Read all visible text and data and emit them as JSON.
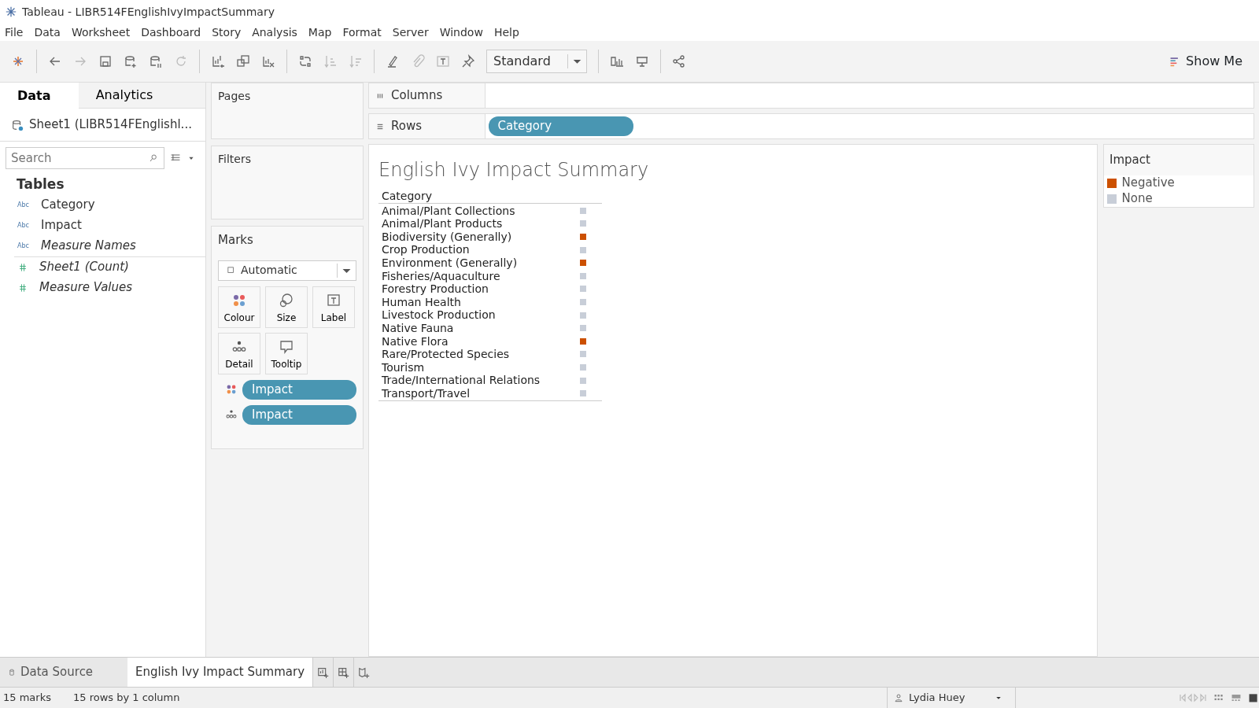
{
  "window": {
    "title": "Tableau - LIBR514FEnglishIvyImpactSummary"
  },
  "menu": [
    "File",
    "Data",
    "Worksheet",
    "Dashboard",
    "Story",
    "Analysis",
    "Map",
    "Format",
    "Server",
    "Window",
    "Help"
  ],
  "toolbar": {
    "fit": "Standard",
    "show_me": "Show Me"
  },
  "data_pane": {
    "tabs": [
      {
        "label": "Data",
        "selected": true
      },
      {
        "label": "Analytics",
        "selected": false
      }
    ],
    "datasource": "Sheet1 (LIBR514FEnglishl...",
    "search": {
      "placeholder": "Search"
    },
    "section": "Tables",
    "fields": [
      {
        "name": "Category",
        "kind": "dimension",
        "type_label": "Abc",
        "generated": false
      },
      {
        "name": "Impact",
        "kind": "dimension",
        "type_label": "Abc",
        "generated": false
      },
      {
        "name": "Measure Names",
        "kind": "dimension",
        "type_label": "Abc",
        "generated": true
      },
      {
        "name": "Sheet1 (Count)",
        "kind": "measure",
        "generated": true
      },
      {
        "name": "Measure Values",
        "kind": "measure",
        "generated": true
      }
    ]
  },
  "shelves": {
    "pages": "Pages",
    "filters": "Filters",
    "columns": {
      "label": "Columns"
    },
    "rows": {
      "label": "Rows",
      "pills": [
        "Category"
      ]
    }
  },
  "marks": {
    "title": "Marks",
    "type": "Automatic",
    "cards": [
      {
        "label": "Colour",
        "kind": "colour"
      },
      {
        "label": "Size",
        "kind": "size"
      },
      {
        "label": "Label",
        "kind": "label"
      },
      {
        "label": "Detail",
        "kind": "detail"
      },
      {
        "label": "Tooltip",
        "kind": "tooltip"
      }
    ],
    "pills": [
      {
        "label": "Impact",
        "kind": "colour"
      },
      {
        "label": "Impact",
        "kind": "detail"
      }
    ]
  },
  "view": {
    "title": "English Ivy Impact Summary",
    "header": "Category",
    "rows": [
      {
        "label": "Animal/Plant Collections",
        "color": "#c8ced8"
      },
      {
        "label": "Animal/Plant Products",
        "color": "#c8ced8"
      },
      {
        "label": "Biodiversity (Generally)",
        "color": "#cc5000"
      },
      {
        "label": "Crop Production",
        "color": "#c8ced8"
      },
      {
        "label": "Environment (Generally)",
        "color": "#cc5000"
      },
      {
        "label": "Fisheries/Aquaculture",
        "color": "#c8ced8"
      },
      {
        "label": "Forestry Production",
        "color": "#c8ced8"
      },
      {
        "label": "Human Health",
        "color": "#c8ced8"
      },
      {
        "label": "Livestock Production",
        "color": "#c8ced8"
      },
      {
        "label": "Native Fauna",
        "color": "#c8ced8"
      },
      {
        "label": "Native Flora",
        "color": "#cc5000"
      },
      {
        "label": "Rare/Protected Species",
        "color": "#c8ced8"
      },
      {
        "label": "Tourism",
        "color": "#c8ced8"
      },
      {
        "label": "Trade/International Relations",
        "color": "#c8ced8"
      },
      {
        "label": "Transport/Travel",
        "color": "#c8ced8"
      }
    ]
  },
  "legend": {
    "title": "Impact",
    "items": [
      {
        "label": "Negative",
        "color": "#cc5000"
      },
      {
        "label": "None",
        "color": "#c8ced8"
      }
    ]
  },
  "sheet_tabs": [
    {
      "label": "Data Source",
      "kind": "datasource",
      "selected": false
    },
    {
      "label": "English Ivy Impact Summary",
      "kind": "sheet",
      "selected": true
    }
  ],
  "status": {
    "marks": "15 marks",
    "size": "15 rows by 1 column",
    "user": "Lydia Huey"
  }
}
